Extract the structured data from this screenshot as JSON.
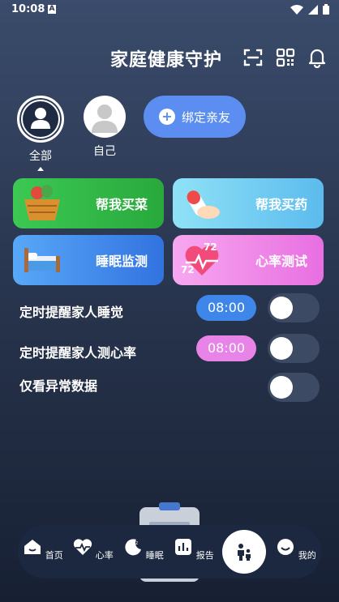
{
  "status_bar": {
    "time": "10:08",
    "notification_icon": "A"
  },
  "header": {
    "title": "家庭健康守护",
    "icons": [
      "scan-icon",
      "qr-code-icon",
      "bell-icon"
    ]
  },
  "members": [
    {
      "label": "全部",
      "selected": true
    },
    {
      "label": "自己",
      "selected": false
    }
  ],
  "bind_button": {
    "label": "绑定亲友"
  },
  "cards": [
    {
      "label": "帮我买菜",
      "color": "#2fbb46"
    },
    {
      "label": "帮我买药",
      "color": "#67c6f1"
    },
    {
      "label": "睡眠监测",
      "color": "#3d7fe8"
    },
    {
      "label": "心率测试",
      "color": "#e86fe1"
    }
  ],
  "heart_badge": "72",
  "reminders": [
    {
      "label": "定时提醒家人睡觉",
      "time": "08:00",
      "pill_color": "#3f86ea",
      "enabled": false
    },
    {
      "label": "定时提醒家人测心率",
      "time": "08:00",
      "pill_color": "#e883e8",
      "enabled": false
    },
    {
      "label": "仅看异常数据",
      "enabled": false
    }
  ],
  "tabbar": [
    {
      "label": "首页",
      "icon": "home-icon"
    },
    {
      "label": "心率",
      "icon": "heart-rate-icon"
    },
    {
      "label": "睡眠",
      "icon": "sleep-moon-icon"
    },
    {
      "label": "报告",
      "icon": "report-chart-icon"
    },
    {
      "label": "",
      "icon": "family-icon"
    },
    {
      "label": "我的",
      "icon": "profile-icon"
    }
  ]
}
